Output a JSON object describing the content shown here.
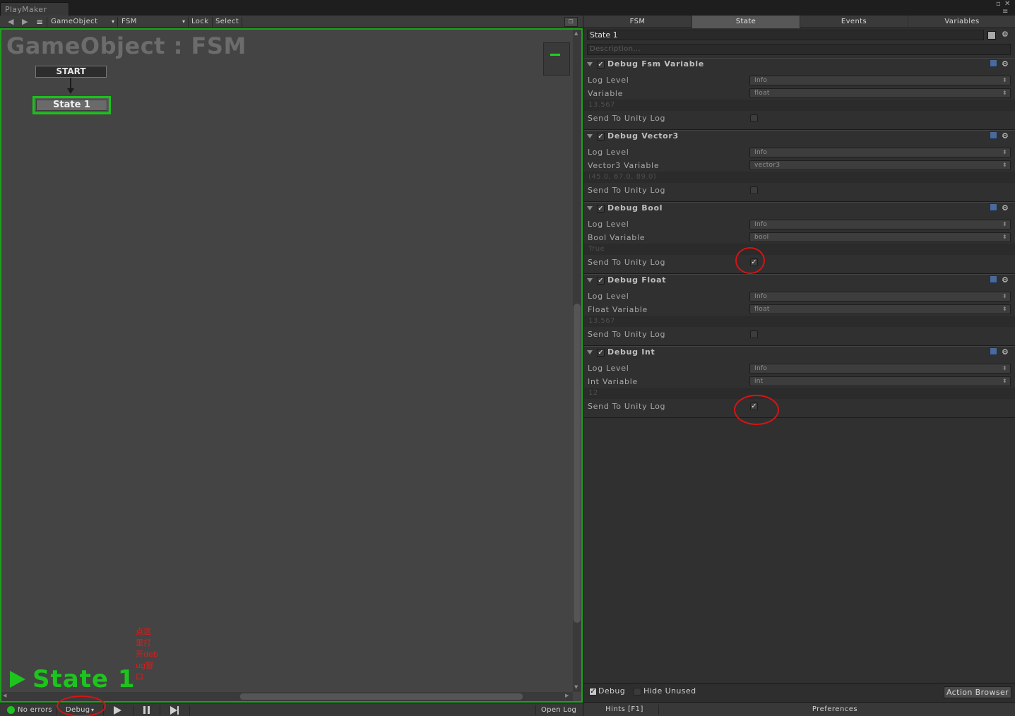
{
  "window": {
    "title": "PlayMaker"
  },
  "toolbar": {
    "back_icon": "arrow-left-icon",
    "forward_icon": "arrow-right-icon",
    "menu_icon": "hamburger-icon",
    "gameobject": "GameObject",
    "fsm": "FSM",
    "lock": "Lock",
    "select": "Select"
  },
  "graph": {
    "title": "GameObject : FSM",
    "start_label": "START",
    "state_label": "State 1",
    "active_state": "State 1",
    "accent_color": "#1fc41f",
    "annotation_note": "点这里打开debug窗口"
  },
  "status": {
    "errors": "No errors",
    "debug": "Debug",
    "open_log": "Open Log"
  },
  "inspector": {
    "tabs": [
      {
        "label": "FSM"
      },
      {
        "label": "State"
      },
      {
        "label": "Events"
      },
      {
        "label": "Variables"
      }
    ],
    "active_tab": "State",
    "state_name": "State 1",
    "description_placeholder": "Description...",
    "actions": [
      {
        "title": "Debug Fsm Variable",
        "log_level_label": "Log Level",
        "log_level": "Info",
        "variable_label": "Variable",
        "variable": "float",
        "value": "13.567",
        "send_label": "Send To Unity Log",
        "send_checked": false
      },
      {
        "title": "Debug Vector3",
        "log_level_label": "Log Level",
        "log_level": "Info",
        "variable_label": "Vector3  Variable",
        "variable": "vector3",
        "value": "(45.0, 67.0, 89.0)",
        "send_label": "Send To Unity Log",
        "send_checked": false
      },
      {
        "title": "Debug Bool",
        "log_level_label": "Log Level",
        "log_level": "Info",
        "variable_label": "Bool Variable",
        "variable": "bool",
        "value": "True",
        "send_label": "Send To Unity Log",
        "send_checked": true
      },
      {
        "title": "Debug Float",
        "log_level_label": "Log Level",
        "log_level": "Info",
        "variable_label": "Float Variable",
        "variable": "float",
        "value": "13.567",
        "send_label": "Send To Unity Log",
        "send_checked": false
      },
      {
        "title": "Debug Int",
        "log_level_label": "Log Level",
        "log_level": "Info",
        "variable_label": "Int Variable",
        "variable": "int",
        "value": "12",
        "send_label": "Send To Unity Log",
        "send_checked": true
      }
    ],
    "footer": {
      "debug_label": "Debug",
      "debug_checked": true,
      "hide_unused_label": "Hide Unused",
      "hide_unused_checked": false,
      "action_browser": "Action Browser"
    },
    "status": {
      "hints": "Hints [F1]",
      "preferences": "Preferences"
    }
  }
}
